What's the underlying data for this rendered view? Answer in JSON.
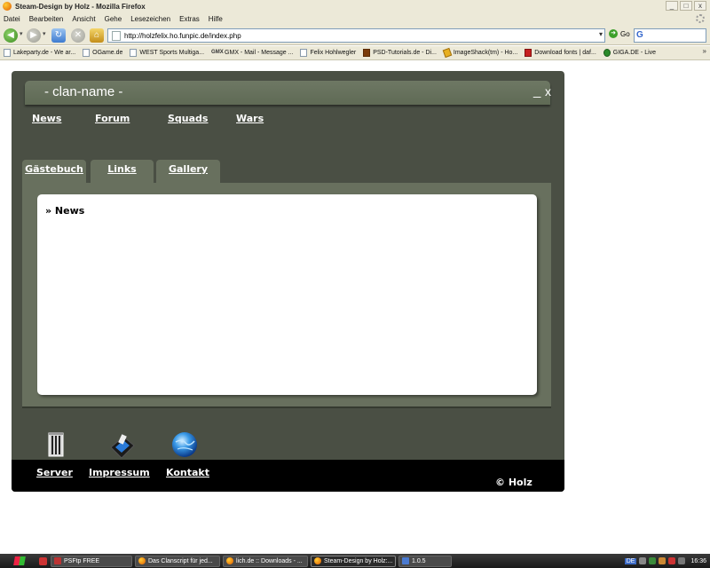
{
  "browser": {
    "window_title": "Steam-Design by Holz - Mozilla Firefox",
    "window_controls": [
      "_",
      "□",
      "x"
    ],
    "menu": [
      "Datei",
      "Bearbeiten",
      "Ansicht",
      "Gehe",
      "Lesezeichen",
      "Extras",
      "Hilfe"
    ],
    "url": "http://holzfelix.ho.funpic.de/index.php",
    "go_label": "Go",
    "search_logo": "G",
    "bookmarks": [
      {
        "label": "Lakeparty.de - We ar...",
        "icon": "page-icon"
      },
      {
        "label": "OGame.de",
        "icon": "page-icon"
      },
      {
        "label": "WEST Sports Multiga...",
        "icon": "page-icon"
      },
      {
        "label": "GMX - Mail - Message ...",
        "icon": "gmx-icon"
      },
      {
        "label": "Felix Hohlwegler",
        "icon": "page-icon"
      },
      {
        "label": "PSD-Tutorials.de - Di...",
        "icon": "psd-icon"
      },
      {
        "label": "ImageShack(tm) - Ho...",
        "icon": "imageshack-icon"
      },
      {
        "label": "Download fonts | daf...",
        "icon": "download-icon"
      },
      {
        "label": "GIGA.DE - Live",
        "icon": "giga-icon"
      }
    ],
    "gmx_text": "GMX",
    "more_glyph": "»"
  },
  "site": {
    "title": "- clan-name -",
    "minimize": "_",
    "close": "x",
    "nav": [
      "News",
      "Forum",
      "Squads",
      "Wars"
    ],
    "tabs": [
      "Gästebuch",
      "Links",
      "Gallery"
    ],
    "content_heading": "» News",
    "footer_links": [
      "Server",
      "Impressum",
      "Kontakt"
    ],
    "copyright": "© Holz",
    "colors": {
      "frame": "#4a4f44",
      "panel": "#68705e",
      "footer": "#000000"
    }
  },
  "taskbar": {
    "tasks": [
      {
        "label": "PSFtp FREE",
        "icon": "psftp-icon",
        "active": false
      },
      {
        "label": "Das Clanscript für jed...",
        "icon": "firefox-icon",
        "active": false
      },
      {
        "label": "lich.de :: Downloads - ...",
        "icon": "firefox-icon",
        "active": false
      },
      {
        "label": "Steam-Design by Holz:...",
        "icon": "firefox-icon",
        "active": true
      },
      {
        "label": "1.0.5",
        "icon": "app-icon",
        "active": false
      }
    ],
    "lang": "DE",
    "clock": "16:36"
  }
}
